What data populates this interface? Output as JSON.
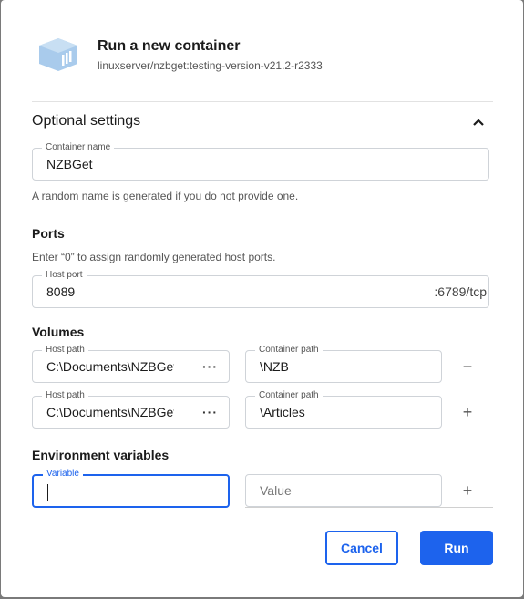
{
  "header": {
    "title": "Run a new container",
    "image": "linuxserver/nzbget:testing-version-v21.2-r2333"
  },
  "optional": {
    "heading": "Optional settings",
    "toggle_icon": "chevron-up-icon"
  },
  "container_name": {
    "label": "Container name",
    "value": "NZBGet",
    "helper": "A random name is generated if you do not provide one."
  },
  "ports": {
    "heading": "Ports",
    "helper": "Enter “0” to assign randomly generated host ports.",
    "host_port_label": "Host port",
    "host_port_value": "8089",
    "container_port": ":6789/tcp"
  },
  "volumes": {
    "heading": "Volumes",
    "rows": [
      {
        "host_label": "Host path",
        "host_value": "C:\\Documents\\NZBGet",
        "browse": "···",
        "container_label": "Container path",
        "container_value": "\\NZB",
        "action": "−"
      },
      {
        "host_label": "Host path",
        "host_value": "C:\\Documents\\NZBGet",
        "browse": "···",
        "container_label": "Container path",
        "container_value": "\\Articles",
        "action": "+"
      }
    ]
  },
  "env": {
    "heading": "Environment variables",
    "variable_label": "Variable",
    "variable_value": "",
    "value_placeholder": "Value",
    "action": "+"
  },
  "actions": {
    "cancel": "Cancel",
    "run": "Run"
  },
  "colors": {
    "accent": "#1d63ed",
    "logo": "#a9cbec"
  }
}
